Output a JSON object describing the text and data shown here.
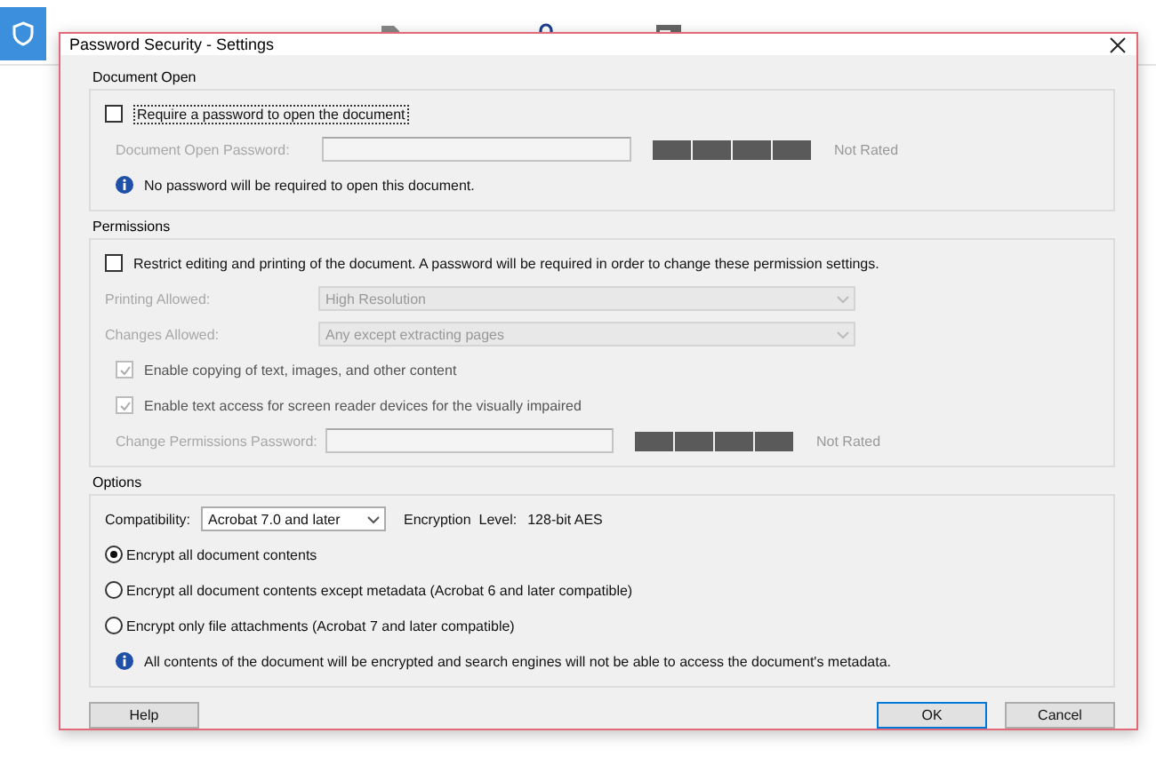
{
  "dialog": {
    "title": "Password Security - Settings",
    "document_open": {
      "title": "Document Open",
      "require_password": {
        "label": "Require a password to open the document",
        "checked": false
      },
      "password": {
        "label": "Document Open Password:",
        "disabled": true,
        "rating": "Not Rated"
      },
      "info": "No password will be required to open this document."
    },
    "permissions": {
      "title": "Permissions",
      "restrict": {
        "label": "Restrict editing and printing of the document. A password will be required in order to change these permission settings.",
        "checked": false
      },
      "selects": [
        {
          "label": "Printing Allowed:",
          "value": "High Resolution",
          "disabled": true
        },
        {
          "label": "Changes Allowed:",
          "value": "Any except extracting pages",
          "disabled": true
        }
      ],
      "checkboxes": [
        {
          "label": "Enable copying of text, images, and other content",
          "checked": true,
          "disabled": true
        },
        {
          "label": "Enable text access for screen reader devices for the visually impaired",
          "checked": true,
          "disabled": true
        }
      ],
      "password": {
        "label": "Change Permissions Password:",
        "disabled": true,
        "rating": "Not Rated"
      }
    },
    "options": {
      "title": "Options",
      "compatibility": {
        "label": "Compatibility:",
        "value": "Acrobat 7.0 and later"
      },
      "encryption_label": "Encryption  Level:",
      "encryption_value": "128-bit AES",
      "radios": [
        {
          "label": "Encrypt all document contents",
          "selected": true
        },
        {
          "label": "Encrypt all document contents except metadata (Acrobat 6 and later compatible)",
          "selected": false
        },
        {
          "label": "Encrypt only file attachments (Acrobat 7 and later compatible)",
          "selected": false
        }
      ],
      "info": "All contents of the document will be encrypted and search engines will not be able to access the document's metadata."
    },
    "buttons": [
      {
        "label": "Help",
        "default": false
      },
      {
        "label": "OK",
        "default": true
      },
      {
        "label": "Cancel",
        "default": false
      }
    ]
  }
}
